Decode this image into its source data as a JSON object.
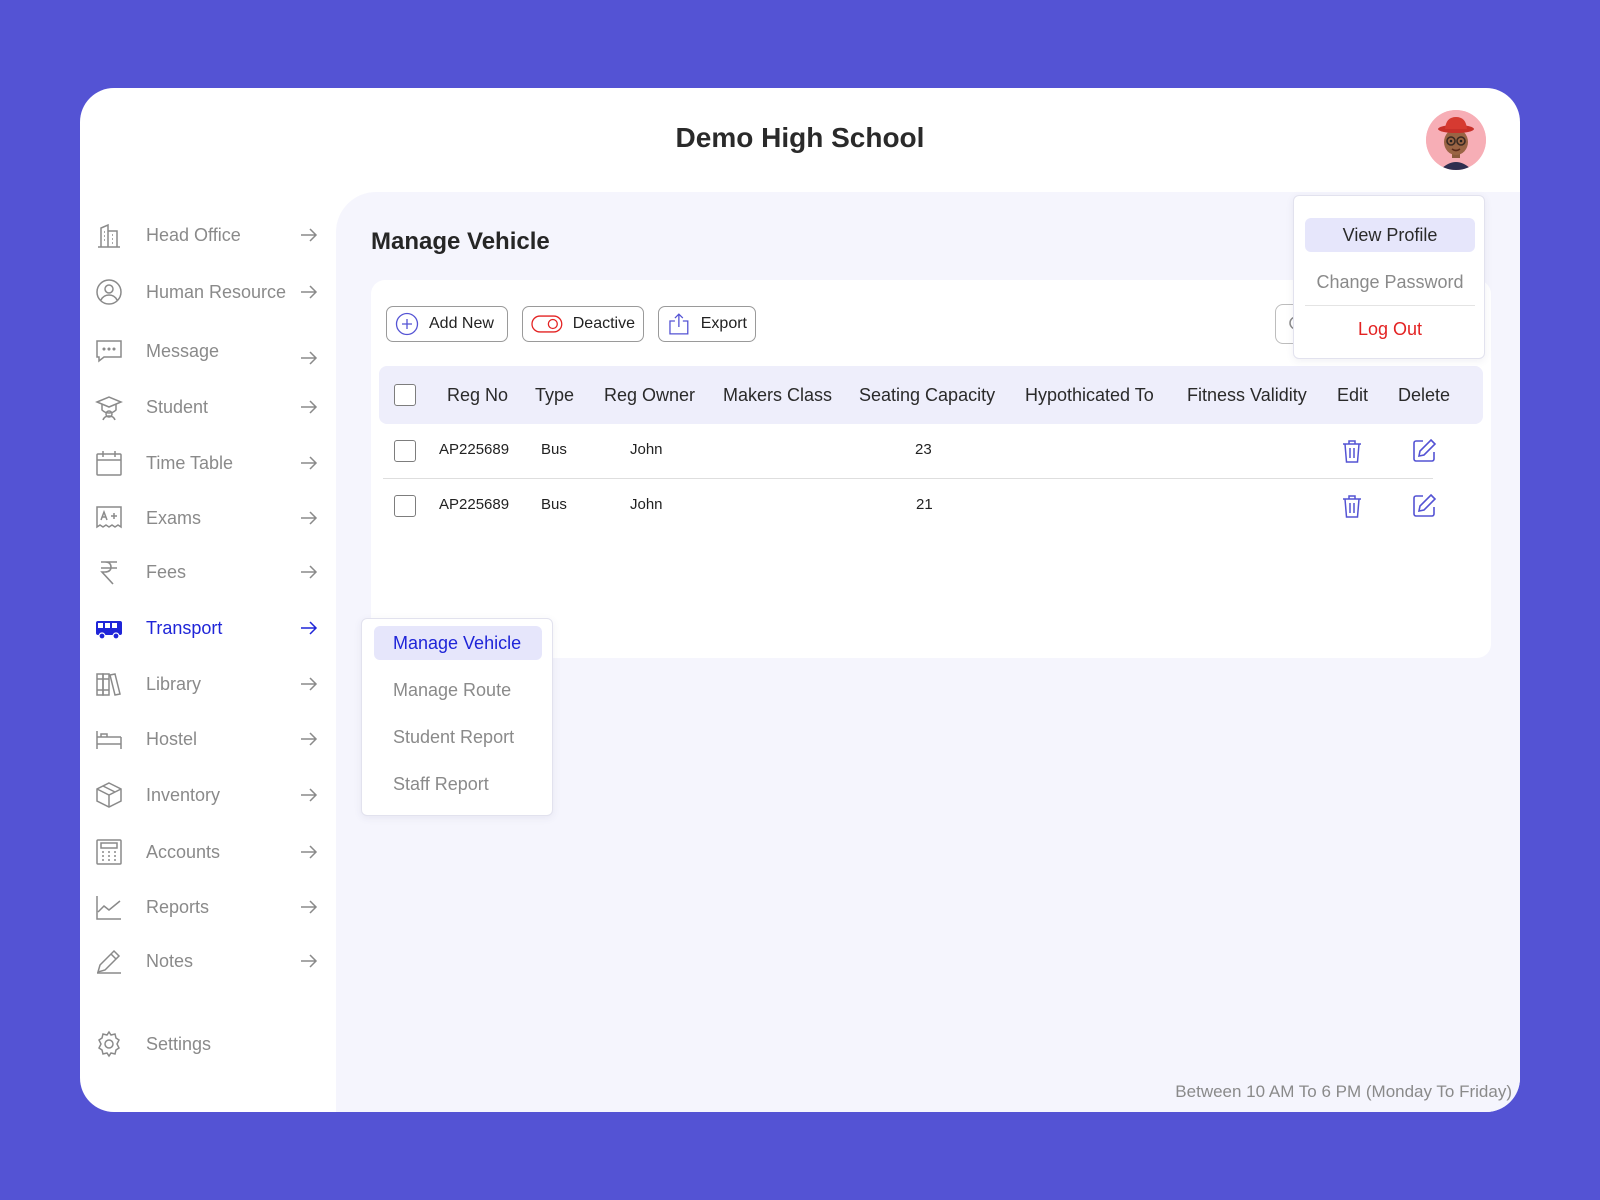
{
  "app": {
    "title": "Demo High School"
  },
  "sidebar": {
    "items": [
      {
        "label": "Head Office",
        "icon": "building-icon"
      },
      {
        "label": "Human Resource",
        "icon": "user-circle-icon"
      },
      {
        "label": "Message",
        "icon": "message-icon"
      },
      {
        "label": "Student",
        "icon": "graduation-cap-icon"
      },
      {
        "label": "Time Table",
        "icon": "calendar-icon"
      },
      {
        "label": "Exams",
        "icon": "exam-grade-icon"
      },
      {
        "label": "Fees",
        "icon": "rupee-icon"
      },
      {
        "label": "Transport",
        "icon": "bus-icon",
        "active": true
      },
      {
        "label": "Library",
        "icon": "books-icon"
      },
      {
        "label": "Hostel",
        "icon": "bed-icon"
      },
      {
        "label": "Inventory",
        "icon": "box-icon"
      },
      {
        "label": "Accounts",
        "icon": "calculator-icon"
      },
      {
        "label": "Reports",
        "icon": "line-chart-icon"
      },
      {
        "label": "Notes",
        "icon": "pencil-icon"
      }
    ],
    "settings_label": "Settings"
  },
  "main": {
    "title": "Manage Vehicle",
    "toolbar": {
      "add_label": "Add New",
      "deactive_label": "Deactive",
      "export_label": "Export"
    },
    "table": {
      "columns": [
        "Reg No",
        "Type",
        "Reg Owner",
        "Makers Class",
        "Seating Capacity",
        "Hypothicated To",
        "Fitness Validity",
        "Edit",
        "Delete"
      ],
      "rows": [
        {
          "reg_no": "AP225689",
          "type": "Bus",
          "owner": "John",
          "makers_class": "",
          "seating": "23",
          "hypothicated": "",
          "fitness": ""
        },
        {
          "reg_no": "AP225689",
          "type": "Bus",
          "owner": "John",
          "makers_class": "",
          "seating": "21",
          "hypothicated": "",
          "fitness": ""
        }
      ]
    },
    "footer_note": "Between 10 AM To 6 PM (Monday To Friday)"
  },
  "transport_menu": {
    "items": [
      {
        "label": "Manage Vehicle",
        "active": true
      },
      {
        "label": "Manage Route"
      },
      {
        "label": "Student Report"
      },
      {
        "label": "Staff Report"
      }
    ]
  },
  "profile_menu": {
    "view_profile": "View Profile",
    "change_password": "Change Password",
    "logout": "Log Out"
  },
  "colors": {
    "background": "#5453d4",
    "accent": "#1f25d8",
    "panel": "#f5f5fd",
    "danger": "#e32222",
    "muted_text": "#8a8a8a"
  }
}
